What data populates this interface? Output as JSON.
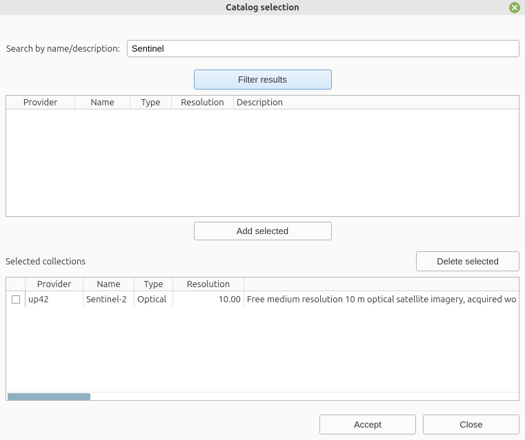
{
  "window": {
    "title": "Catalog selection"
  },
  "search": {
    "label": "Search by name/description:",
    "value": "Sentinel"
  },
  "buttons": {
    "filter": "Filter results",
    "add_selected": "Add selected",
    "delete_selected": "Delete selected",
    "accept": "Accept",
    "close": "Close"
  },
  "results_table": {
    "headers": {
      "provider": "Provider",
      "name": "Name",
      "type": "Type",
      "resolution": "Resolution",
      "description": "Description"
    },
    "rows": []
  },
  "selected_section": {
    "label": "Selected collections"
  },
  "selected_table": {
    "headers": {
      "provider": "Provider",
      "name": "Name",
      "type": "Type",
      "resolution": "Resolution"
    },
    "rows": [
      {
        "checked": false,
        "provider": "up42",
        "name": "Sentinel-2",
        "type": "Optical",
        "resolution": "10.00",
        "description": "Free medium resolution 10 m optical satellite imagery, acquired wo"
      }
    ]
  }
}
